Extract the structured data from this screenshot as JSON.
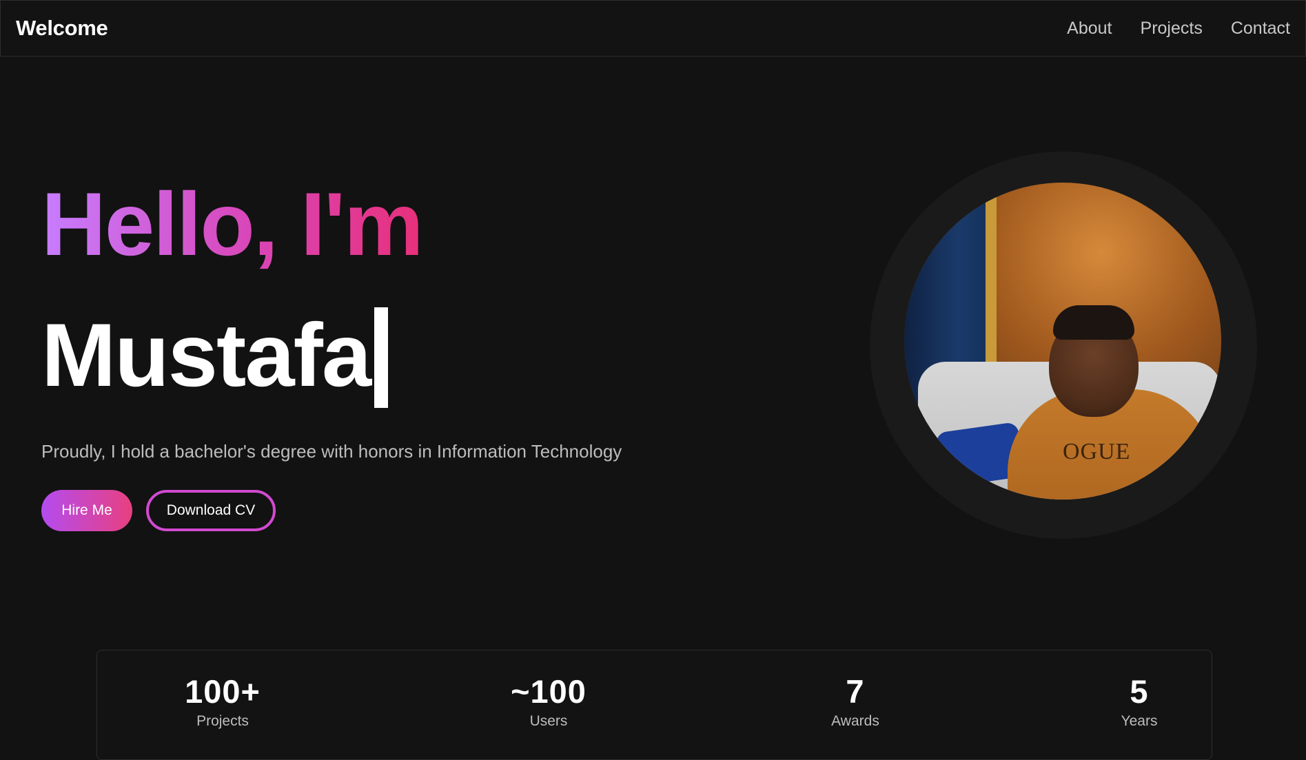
{
  "navbar": {
    "brand": "Welcome",
    "links": [
      "About",
      "Projects",
      "Contact"
    ]
  },
  "hero": {
    "greeting": "Hello, I'm",
    "name": "Mustafa",
    "tagline": "Proudly, I hold a bachelor's degree with honors in Information Technology",
    "primary_button": "Hire Me",
    "secondary_button": "Download CV"
  },
  "profile_photo": {
    "shirt_text": "OGUE"
  },
  "stats": [
    {
      "value": "100+",
      "label": "Projects"
    },
    {
      "value": "~100",
      "label": "Users"
    },
    {
      "value": "7",
      "label": "Awards"
    },
    {
      "value": "5",
      "label": "Years"
    }
  ],
  "colors": {
    "background": "#121212",
    "accent_start": "#b44cf0",
    "accent_end": "#e8407f"
  }
}
